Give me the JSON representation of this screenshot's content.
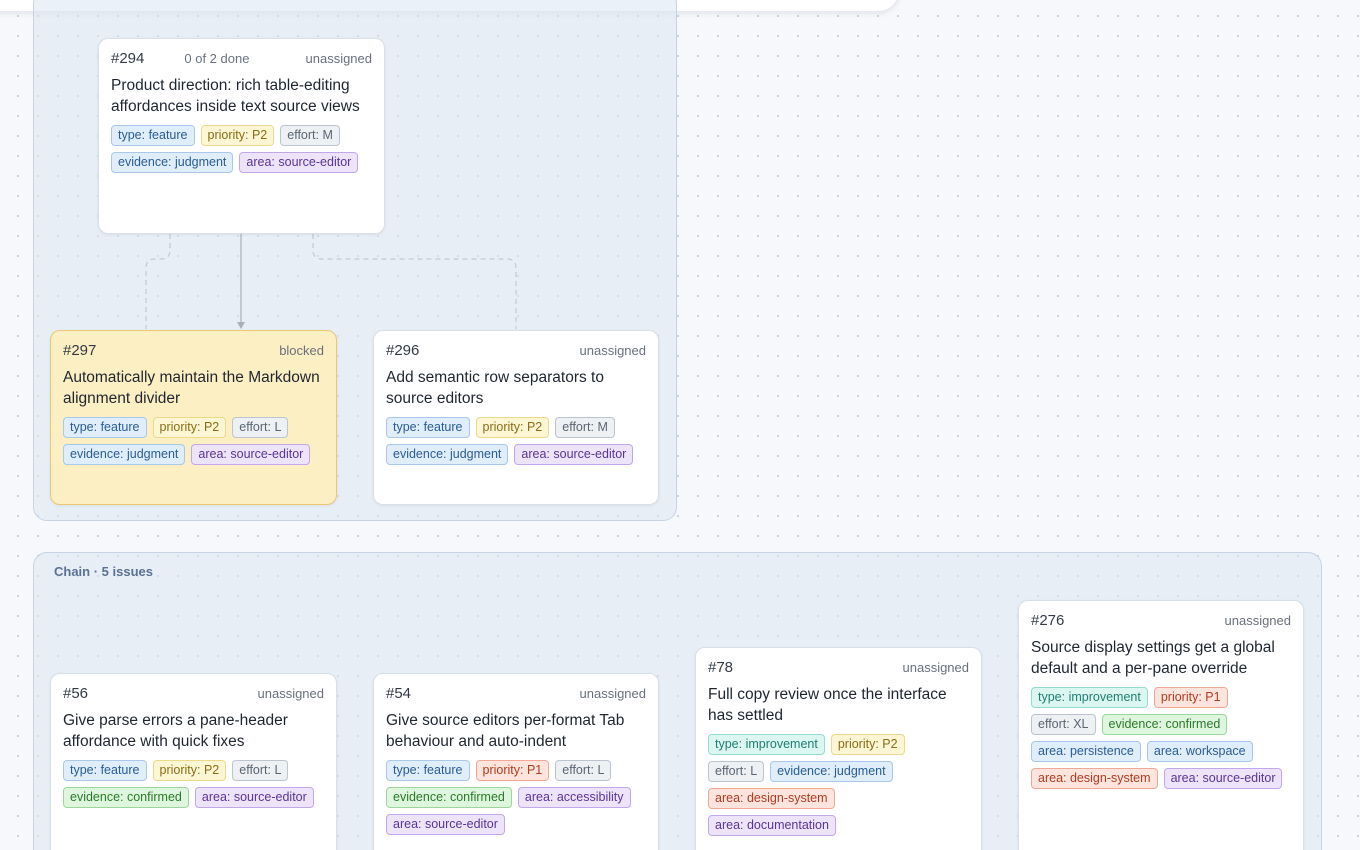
{
  "groups": [
    {
      "label": ""
    },
    {
      "label": "Chain · 5 issues"
    }
  ],
  "cards": [
    {
      "id": "#294",
      "progress": "0 of 2 done",
      "status": "unassigned",
      "title": "Product direction: rich table-editing affordances inside text source views",
      "chips": [
        "type: feature",
        "priority: P2",
        "effort: M",
        "evidence: judgment",
        "area: source-editor"
      ]
    },
    {
      "id": "#297",
      "status": "blocked",
      "title": "Automatically maintain the Markdown alignment divider",
      "chips": [
        "type: feature",
        "priority: P2",
        "effort: L",
        "evidence: judgment",
        "area: source-editor"
      ]
    },
    {
      "id": "#296",
      "status": "unassigned",
      "title": "Add semantic row separators to source editors",
      "chips": [
        "type: feature",
        "priority: P2",
        "effort: M",
        "evidence: judgment",
        "area: source-editor"
      ]
    },
    {
      "id": "#56",
      "status": "unassigned",
      "title": "Give parse errors a pane-header affordance with quick fixes",
      "chips": [
        "type: feature",
        "priority: P2",
        "effort: L",
        "evidence: confirmed",
        "area: source-editor"
      ]
    },
    {
      "id": "#54",
      "status": "unassigned",
      "title": "Give source editors per-format Tab behaviour and auto-indent",
      "chips": [
        "type: feature",
        "priority: P1",
        "effort: L",
        "evidence: confirmed",
        "area: accessibility",
        "area: source-editor"
      ]
    },
    {
      "id": "#78",
      "status": "unassigned",
      "title": "Full copy review once the interface has settled",
      "chips": [
        "type: improvement",
        "priority: P2",
        "effort: L",
        "evidence: judgment",
        "area: design-system",
        "area: documentation"
      ]
    },
    {
      "id": "#276",
      "status": "unassigned",
      "title": "Source display settings get a global default and a per-pane override",
      "chips": [
        "type: improvement",
        "priority: P1",
        "effort: XL",
        "evidence: confirmed",
        "area: persistence",
        "area: workspace",
        "area: design-system",
        "area: source-editor"
      ]
    }
  ],
  "colors": {
    "canvas": "#f6f8fb",
    "group_fill": "#dbe5f3",
    "blocked_card": "#fcefc4",
    "edge": "#b8bec8"
  }
}
